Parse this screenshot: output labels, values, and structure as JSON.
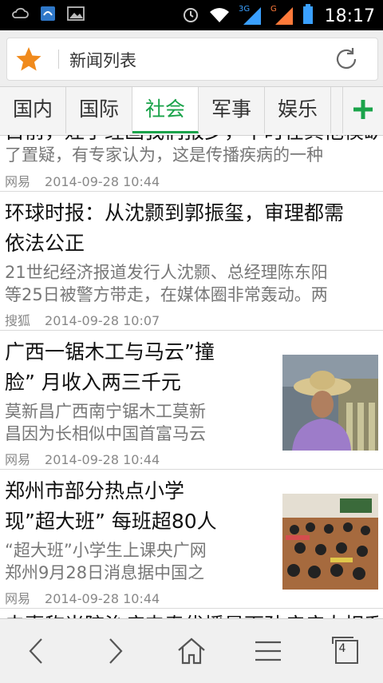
{
  "status_bar": {
    "time": "18:17",
    "network_3g": "3G",
    "network_g": "G"
  },
  "address_bar": {
    "title": "新闻列表"
  },
  "tabs": [
    {
      "label": "国内"
    },
    {
      "label": "国际"
    },
    {
      "label": "社会",
      "active": true
    },
    {
      "label": "军事"
    },
    {
      "label": "娱乐"
    }
  ],
  "articles": [
    {
      "title_partial": "目前，娃手经画我们报步，不时在其他模缺到",
      "summary": "了置疑，有专家认为，这是传播疾病的一种",
      "source": "网易",
      "date": "2014-09-28 10:44"
    },
    {
      "title_line1": "环球时报：从沈颢到郭振玺，审理都需",
      "title_line2": "依法公正",
      "summary_line1": "21世纪经济报道发行人沈颢、总经理陈东阳",
      "summary_line2": "等25日被警方带走，在媒体圈非常轰动。两",
      "source": "搜狐",
      "date": "2014-09-28 10:07"
    },
    {
      "title_line1": "广西一锯木工与马云”撞",
      "title_line2": "脸” 月收入两三千元",
      "summary_line1": "莫新昌广西南宁锯木工莫新",
      "summary_line2": "昌因为长相似中国首富马云",
      "source": "网易",
      "date": "2014-09-28 10:44"
    },
    {
      "title_line1": "郑州市部分热点小学",
      "title_line2": "现”超大班” 每班超80人",
      "summary_line1": "“超大班”小学生上课央广网",
      "summary_line2": "郑州9月28日消息据中国之",
      "source": "网易",
      "date": "2014-09-28 10:44"
    },
    {
      "title_partial": "夫妻称当院治病申奏优播是面孙病病大相系"
    }
  ],
  "toolbar": {
    "tab_count": "4"
  },
  "colors": {
    "accent_green": "#1aa34a",
    "star_orange": "#f08a1c"
  }
}
